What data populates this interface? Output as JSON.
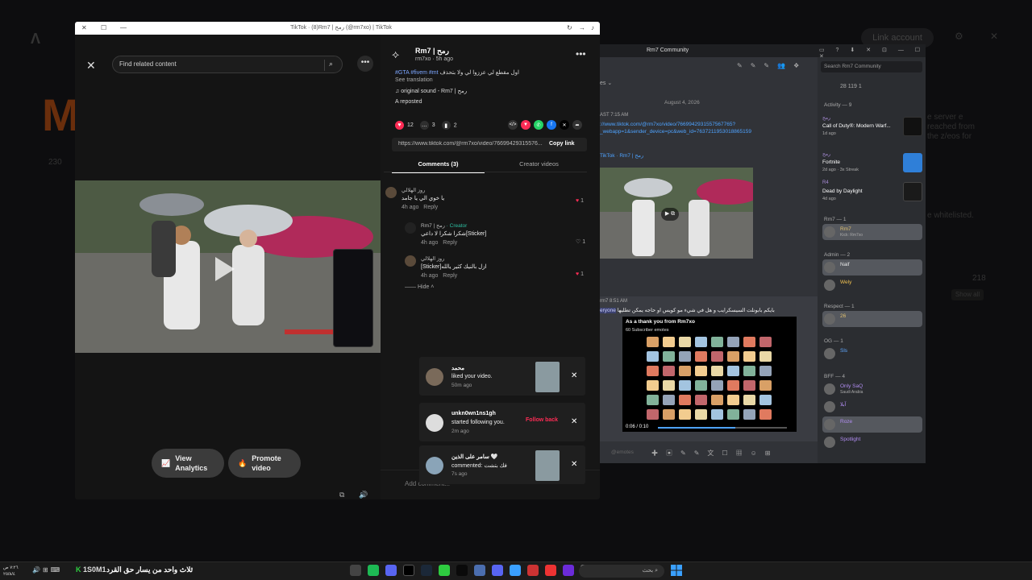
{
  "background": {
    "logo": "Λ",
    "link_account": "Link account",
    "big_letter": "M",
    "count": "230",
    "side_text": "e server e reached from the z/eos for",
    "whitelisted": "e whitelisted.",
    "number": "218",
    "show_all": "Show all"
  },
  "tiktok": {
    "window_title": "TikTok · (8)Rm7 | رمح (@rm7xo) | TikTok",
    "search_placeholder": "Find related content",
    "author": "Rm7 | رمح",
    "handle_time": "rm7xo · 5h ago",
    "caption_text": "اول مقطع لي عززوا لي ولا بتحذف",
    "caption_tags": "#GTA #fivem #mt",
    "see_translation": "See translation",
    "sound": "original sound - Rm7 | رمح",
    "reposted": "A reposted",
    "likes": "12",
    "comments_count": "3",
    "saves": "2",
    "link_url": "https://www.tiktok.com/@rm7xo/video/76699429315576...",
    "copy_link": "Copy link",
    "tab_comments": "Comments (3)",
    "tab_creator": "Creator videos",
    "view_analytics": "View Analytics",
    "promote_video": "Promote video",
    "add_comment": "Add comment...",
    "hide": "Hide",
    "comments": [
      {
        "name": "روز الهلالي",
        "text": "يا خوي الي يا جامد",
        "time": "4h ago",
        "reply": "Reply",
        "likes": "1"
      },
      {
        "name": "Rm7 | رمح",
        "creator": "· Creator",
        "text": "شكرا شكرا لا داعي[Sticker]",
        "time": "4h ago",
        "reply": "Reply",
        "likes": "1"
      },
      {
        "name": "روز الهلالي",
        "text": "[Sticker]ازل بالنيك كثير يالله",
        "time": "4h ago",
        "reply": "Reply",
        "likes": "1"
      }
    ]
  },
  "notifications": [
    {
      "title": "محمد",
      "text": "liked your video.",
      "time": "50m ago"
    },
    {
      "title": "unkn0wn1ns1gh",
      "text": "started following you.",
      "time": "2m ago",
      "action": "Follow back"
    },
    {
      "title": "سامر على الذين 🤍",
      "text": "commented: فك بتشت",
      "time": "7s ago"
    }
  ],
  "discord": {
    "window_title": "Rm7 Community",
    "search_placeholder": "Search Rm7 Community",
    "stats": "28   119   1",
    "date_divider": "August 4, 2026",
    "msg1_meta": "AST  7:15 AM",
    "msg1_link": "://www.tiktok.com/@rm7xo/video/7669942931557567765?_webapp=1&sender_device=pc&web_id=7637211953018865159",
    "embed_title": "TikTok · Rm7 | رمح",
    "msg2_meta": "rm7  8:51 AM",
    "msg2_mention": "eryone",
    "msg2_text": "بايكم بابونلت  السيسكرايب و هل في شيء مو كويس او حاجه يمكن تطليها",
    "emotes_title": "As a thank you from Rm7xo",
    "emotes_sub": "60 Subscriber emotes",
    "video_time": "0:06 / 0:10",
    "video_progress": 0.6,
    "input_placeholder": "@emotes",
    "activity_header": "Activity — 9",
    "activities": [
      {
        "user": "رمح",
        "game": "Call of Duty®: Modern Warf...",
        "status": "1d ago"
      },
      {
        "user": "رمح",
        "game": "Fortnite",
        "status": "2d ago  ·  3x Streak"
      },
      {
        "user": "R4",
        "game": "Dead by Daylight",
        "status": "4d ago"
      }
    ],
    "roles": [
      {
        "header": "Rm7 — 1",
        "members": [
          {
            "name": "Rm7",
            "sub": "Kick: Rm7xo"
          }
        ]
      },
      {
        "header": "Admin — 2",
        "members": [
          {
            "name": "Naif",
            "sub": ""
          },
          {
            "name": "Wely",
            "sub": ""
          }
        ]
      },
      {
        "header": "Respect — 1",
        "members": [
          {
            "name": "26",
            "sub": ""
          }
        ]
      },
      {
        "header": "OG — 1",
        "members": [
          {
            "name": "Sls",
            "sub": ""
          }
        ]
      },
      {
        "header": "BFF — 4",
        "members": [
          {
            "name": "Only SaQ",
            "sub": "Saudi Arabia"
          },
          {
            "name": "آبلا",
            "sub": ""
          },
          {
            "name": "Roze",
            "sub": ""
          },
          {
            "name": "Spotlight",
            "sub": ""
          }
        ]
      }
    ]
  },
  "taskbar": {
    "clock": "٧:٢٦ ص\n٢٥/٨/٤",
    "stock": "1S0M1",
    "news": "ثلاث واحد من يسار حق القرد",
    "search": "بحث"
  },
  "colors": {
    "tiktok_red": "#fe2c55",
    "discord_bg": "#313338",
    "link_blue": "#4ea3ff"
  }
}
